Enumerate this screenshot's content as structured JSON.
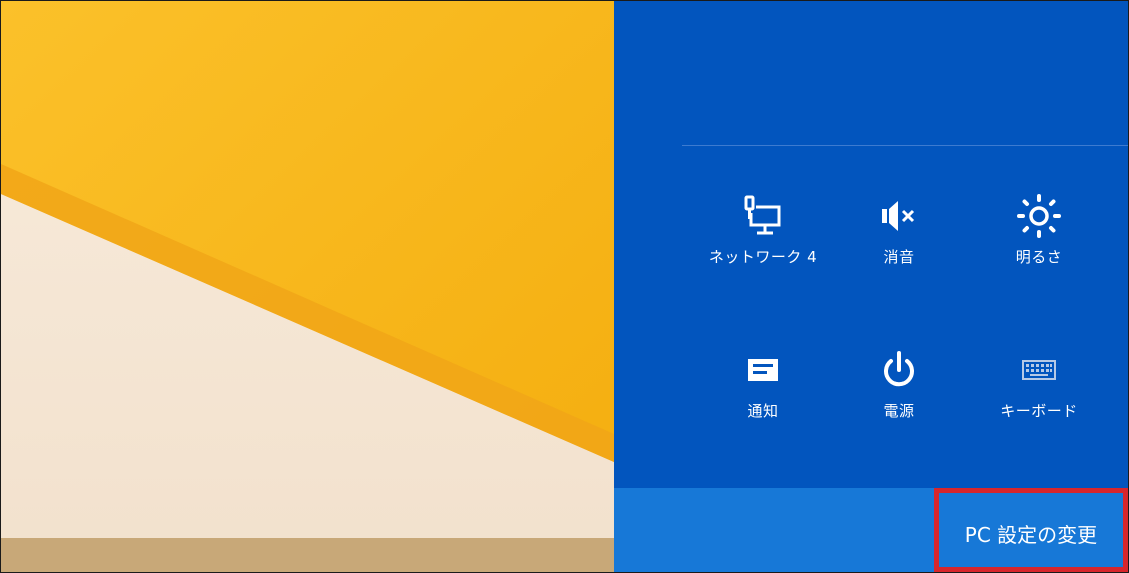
{
  "quick_settings": [
    {
      "label": "ネットワーク 4",
      "icon": "network-icon"
    },
    {
      "label": "消音",
      "icon": "volume-muted-icon"
    },
    {
      "label": "明るさ",
      "icon": "brightness-icon"
    },
    {
      "label": "通知",
      "icon": "notifications-icon"
    },
    {
      "label": "電源",
      "icon": "power-icon"
    },
    {
      "label": "キーボード",
      "icon": "keyboard-icon"
    }
  ],
  "footer": {
    "change_pc_settings": "PC 設定の変更"
  },
  "colors": {
    "charm_background": "#0255be",
    "footer_background": "#1778d7",
    "highlight_border": "#d8262c",
    "wallpaper_yellow": "#f6b617",
    "wallpaper_cream": "#f5e6d6"
  }
}
